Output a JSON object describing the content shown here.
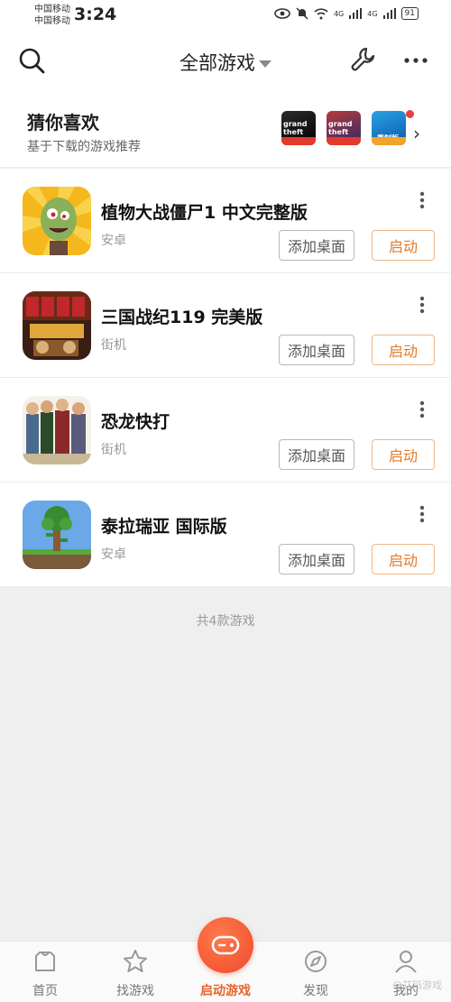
{
  "status": {
    "carrier1": "中国移动",
    "carrier2": "中国移动",
    "time": "3:24",
    "signal1": "4G",
    "signal2": "4G",
    "battery": "91"
  },
  "topbar": {
    "title": "全部游戏"
  },
  "guess": {
    "title": "猜你喜欢",
    "subtitle": "基于下载的游戏推荐",
    "thumbs": [
      "grand theft auto",
      "grand theft auto",
      "重制版"
    ]
  },
  "games": [
    {
      "name": "植物大战僵尸1 中文完整版",
      "platform": "安卓",
      "add_label": "添加桌面",
      "start_label": "启动"
    },
    {
      "name": "三国战纪119 完美版",
      "platform": "街机",
      "add_label": "添加桌面",
      "start_label": "启动"
    },
    {
      "name": "恐龙快打",
      "platform": "街机",
      "add_label": "添加桌面",
      "start_label": "启动"
    },
    {
      "name": "泰拉瑞亚 国际版",
      "platform": "安卓",
      "add_label": "添加桌面",
      "start_label": "启动"
    }
  ],
  "count_text": "共4款游戏",
  "nav": [
    {
      "label": "首页",
      "icon": "home-icon"
    },
    {
      "label": "找游戏",
      "icon": "star-icon"
    },
    {
      "label": "启动游戏",
      "icon": "gamepad-icon"
    },
    {
      "label": "发现",
      "icon": "compass-icon"
    },
    {
      "label": "我的",
      "icon": "user-icon"
    }
  ],
  "watermark": "@艾玛游戏",
  "colors": {
    "accent": "#e8642b",
    "start_border": "#ecb88a"
  }
}
